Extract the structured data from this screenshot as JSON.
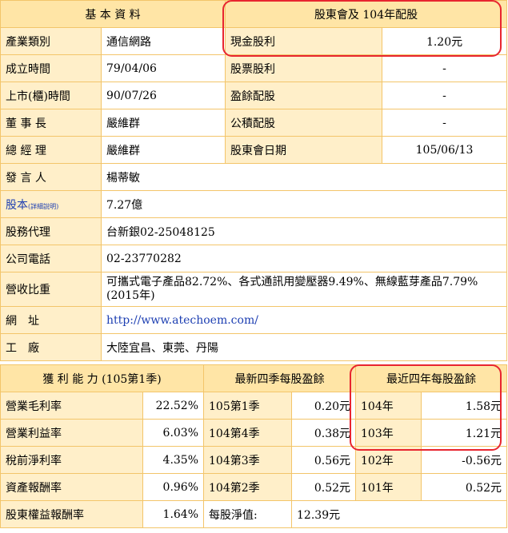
{
  "basic": {
    "header": "基 本 資 料",
    "rows": [
      {
        "label": "產業類別",
        "value": "通信網路"
      },
      {
        "label": "成立時間",
        "value": "79/04/06"
      },
      {
        "label": "上市(櫃)時間",
        "value": "90/07/26"
      },
      {
        "label": "董 事 長",
        "value": "嚴維群"
      },
      {
        "label": "總 經 理",
        "value": "嚴維群"
      },
      {
        "label": "發 言 人",
        "value": "楊蒂敏"
      },
      {
        "label": "股本",
        "label_note": "(詳細說明)",
        "value": "7.27億"
      },
      {
        "label": "股務代理",
        "value": "台新銀02-25048125"
      },
      {
        "label": "公司電話",
        "value": "02-23770282"
      },
      {
        "label": "營收比重",
        "value": "可攜式電子產品82.72%、各式通訊用變壓器9.49%、無線藍芽產品7.79% (2015年)"
      },
      {
        "label": "網　址",
        "value": "http://www.atechoem.com/"
      },
      {
        "label": "工　廠",
        "value": "大陸宜昌、東莞、丹陽"
      }
    ]
  },
  "dividend": {
    "header": "股東會及 104年配股",
    "rows": [
      {
        "label": "現金股利",
        "value": "1.20元"
      },
      {
        "label": "股票股利",
        "value": "-"
      },
      {
        "label": "盈餘配股",
        "value": "-"
      },
      {
        "label": "公積配股",
        "value": "-"
      },
      {
        "label": "股東會日期",
        "value": "105/06/13"
      }
    ]
  },
  "profit": {
    "header": "獲 利 能 力 (105第1季)",
    "rows": [
      {
        "label": "營業毛利率",
        "value": "22.52%"
      },
      {
        "label": "營業利益率",
        "value": "6.03%"
      },
      {
        "label": "稅前淨利率",
        "value": "4.35%"
      },
      {
        "label": "資產報酬率",
        "value": "0.96%"
      },
      {
        "label": "股東權益報酬率",
        "value": "1.64%"
      }
    ]
  },
  "quarter_eps": {
    "header": "最新四季每股盈餘",
    "rows": [
      {
        "label": "105第1季",
        "value": "0.20元"
      },
      {
        "label": "104第4季",
        "value": "0.38元"
      },
      {
        "label": "104第3季",
        "value": "0.56元"
      },
      {
        "label": "104第2季",
        "value": "0.52元"
      }
    ],
    "nav_label": "每股淨值:",
    "nav_value": "12.39元"
  },
  "annual_eps": {
    "header": "最近四年每股盈餘",
    "rows": [
      {
        "label": "104年",
        "value": "1.58元"
      },
      {
        "label": "103年",
        "value": "1.21元"
      },
      {
        "label": "102年",
        "value": "-0.56元"
      },
      {
        "label": "101年",
        "value": "0.52元"
      }
    ]
  },
  "colors": {
    "border": "#f3c56a",
    "header_bg": "#ffe5a6",
    "label_bg": "#ffefc9",
    "highlight": "#e8252f",
    "link": "#1d3fb2"
  }
}
